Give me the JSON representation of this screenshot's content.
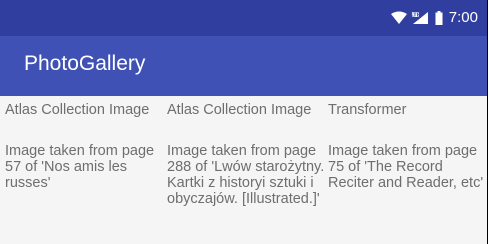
{
  "status_bar": {
    "time": "7:00",
    "icons": [
      "wifi-icon",
      "signal-lte-icon",
      "battery-icon"
    ]
  },
  "app_bar": {
    "title": "PhotoGallery"
  },
  "gallery": {
    "items": [
      {
        "title": "Atlas Collection Image",
        "description": "Image taken from page 57 of 'Nos amis les russes'"
      },
      {
        "title": "Atlas Collection Image",
        "description": "Image taken from page 288 of 'Lwów starożytny. Kartki z historyi sztuki i obyczajów. [Illustrated.]'"
      },
      {
        "title": "Transformer",
        "description": "Image taken from page 75 of 'The Record Reciter and Reader, etc'"
      }
    ]
  },
  "colors": {
    "status_bar": "#303f9f",
    "app_bar": "#3f51b5",
    "content_bg": "#f5f5f5",
    "text": "#6e6e6e"
  }
}
